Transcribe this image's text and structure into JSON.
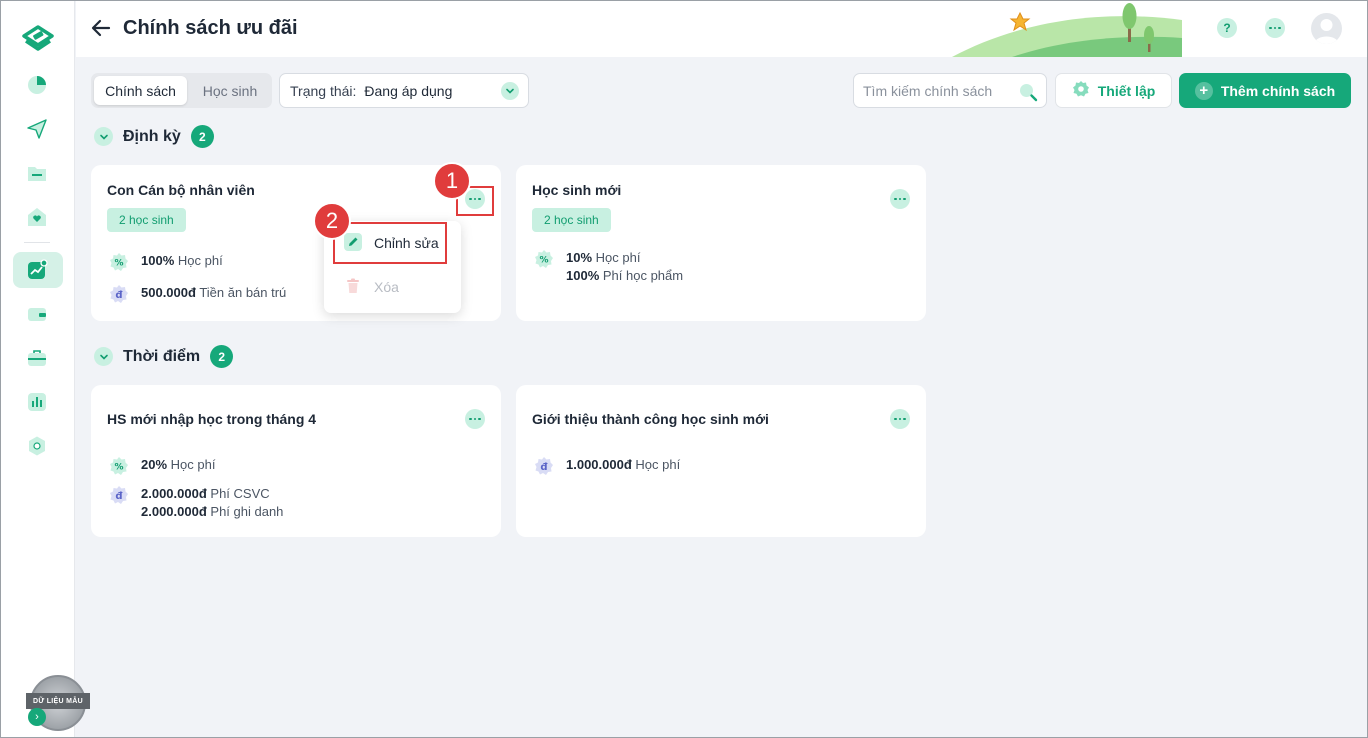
{
  "header": {
    "title": "Chính sách ưu đãi",
    "help_glyph": "?"
  },
  "tabs": [
    {
      "label": "Chính sách",
      "active": true
    },
    {
      "label": "Học sinh",
      "active": false
    }
  ],
  "status_filter": {
    "label": "Trạng thái:",
    "value": "Đang áp dụng"
  },
  "search": {
    "placeholder": "Tìm kiếm chính sách"
  },
  "buttons": {
    "setup": "Thiết lập",
    "add": "Thêm chính sách"
  },
  "sections": [
    {
      "title": "Định kỳ",
      "count": "2",
      "cards": [
        {
          "title": "Con Cán bộ nhân viên",
          "badge": "2 học sinh",
          "lines": [
            {
              "icon": "percent-icon",
              "amount": "100%",
              "label": "Học phí"
            },
            {
              "icon": "currency-icon",
              "amount": "500.000đ",
              "label": "Tiền ăn bán trú"
            }
          ]
        },
        {
          "title": "Học sinh mới",
          "badge": "2 học sinh",
          "lines": [
            {
              "icon": "percent-icon",
              "amount": "10%",
              "label": "Học phí"
            },
            {
              "icon": "none",
              "amount": "100%",
              "label": "Phí học phẩm"
            }
          ]
        }
      ]
    },
    {
      "title": "Thời điểm",
      "count": "2",
      "cards": [
        {
          "title": "HS mới nhập học trong tháng 4",
          "lines": [
            {
              "icon": "percent-icon",
              "amount": "20%",
              "label": "Học phí"
            },
            {
              "icon": "currency-icon",
              "amount": "2.000.000đ",
              "label": "Phí CSVC"
            },
            {
              "icon": "none",
              "amount": "2.000.000đ",
              "label": "Phí ghi danh"
            }
          ]
        },
        {
          "title": "Giới thiệu thành công học sinh mới",
          "lines": [
            {
              "icon": "currency-icon",
              "amount": "1.000.000đ",
              "label": "Học phí"
            }
          ]
        }
      ]
    }
  ],
  "context_menu": {
    "edit": "Chỉnh sửa",
    "delete": "Xóa"
  },
  "annotations": {
    "step1": "1",
    "step2": "2"
  },
  "watermark": "DỮ LIỆU MẪU",
  "colors": {
    "primary": "#16a87a",
    "primary_soft": "#c8f0e1",
    "annotation": "#e03c3c",
    "background": "#f1f3f7"
  }
}
